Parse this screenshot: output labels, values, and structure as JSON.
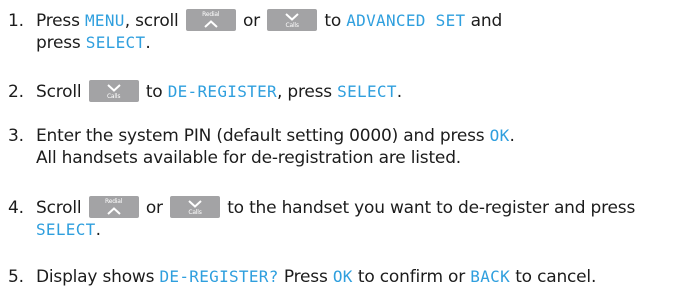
{
  "steps": [
    {
      "number": "1.",
      "t1": "Press ",
      "d1": "MENU",
      "t2": ", scroll ",
      "t3": " or ",
      "t4": " to ",
      "d2": "ADVANCED SET",
      "t5": " and",
      "t6": "press ",
      "d3": "SELECT",
      "t7": "."
    },
    {
      "number": "2.",
      "t1": "Scroll ",
      "t2": " to ",
      "d1": "DE-REGISTER",
      "t3": ", press ",
      "d2": "SELECT",
      "t4": "."
    },
    {
      "number": "3.",
      "t1": "Enter the system PIN (default setting 0000) and press ",
      "d1": "OK",
      "t2": ".",
      "t3": "All handsets available for de-registration are listed."
    },
    {
      "number": "4.",
      "t1": "Scroll ",
      "t2": " or ",
      "t3": " to the handset you want to de-register and press",
      "d1": "SELECT",
      "t4": "."
    },
    {
      "number": "5.",
      "t1": "Display shows ",
      "d1": "DE-REGISTER?",
      "t2": " Press ",
      "d2": "OK",
      "t3": " to confirm or ",
      "d3": "BACK",
      "t4": " to cancel."
    }
  ],
  "keys": {
    "redial": {
      "label": "Redial",
      "icon": "chevron-up-icon"
    },
    "calls": {
      "label": "Calls",
      "icon": "chevron-down-icon"
    }
  },
  "colors": {
    "text": "#1c1c1c",
    "display_text": "#2f9fde",
    "key_background": "#a3a3a5",
    "key_foreground": "#ffffff"
  }
}
